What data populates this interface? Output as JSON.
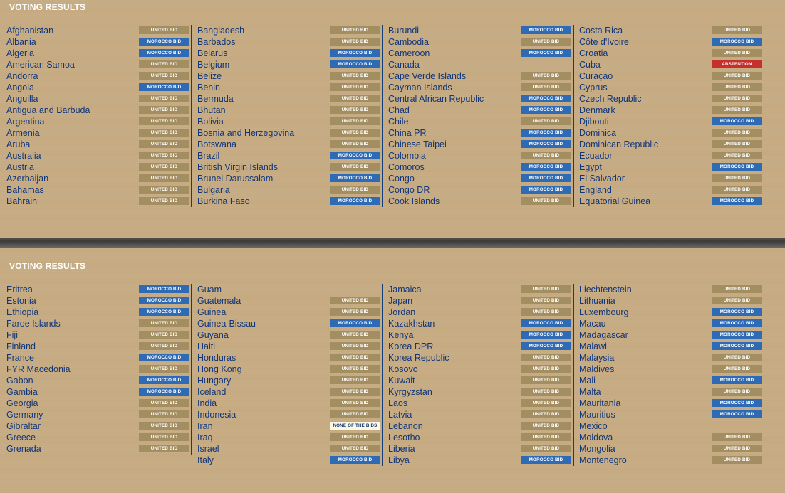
{
  "colors": {
    "background": "#c6ab82",
    "country_text": "#11367a",
    "united_bid": "#a38e62",
    "morocco_bid": "#2f6bb4",
    "abstention": "#c4302c",
    "none_of_the_bids": "#fbf8e6"
  },
  "panels": [
    {
      "title": "VOTING RESULTS",
      "columns": [
        [
          {
            "country": "Afghanistan",
            "vote": "UNITED BID"
          },
          {
            "country": "Albania",
            "vote": "MOROCCO BID"
          },
          {
            "country": "Algeria",
            "vote": "MOROCCO BID"
          },
          {
            "country": "American Samoa",
            "vote": "UNITED BID"
          },
          {
            "country": "Andorra",
            "vote": "UNITED BID"
          },
          {
            "country": "Angola",
            "vote": "MOROCCO BID"
          },
          {
            "country": "Anguilla",
            "vote": "UNITED BID"
          },
          {
            "country": "Antigua and Barbuda",
            "vote": "UNITED BID"
          },
          {
            "country": "Argentina",
            "vote": "UNITED BID"
          },
          {
            "country": "Armenia",
            "vote": "UNITED BID"
          },
          {
            "country": "Aruba",
            "vote": "UNITED BID"
          },
          {
            "country": "Australia",
            "vote": "UNITED BID"
          },
          {
            "country": "Austria",
            "vote": "UNITED BID"
          },
          {
            "country": "Azerbaijan",
            "vote": "UNITED BID"
          },
          {
            "country": "Bahamas",
            "vote": "UNITED BID"
          },
          {
            "country": "Bahrain",
            "vote": "UNITED BID"
          }
        ],
        [
          {
            "country": "Bangladesh",
            "vote": "UNITED BID"
          },
          {
            "country": "Barbados",
            "vote": "UNITED BID"
          },
          {
            "country": "Belarus",
            "vote": "MOROCCO BID"
          },
          {
            "country": "Belgium",
            "vote": "MOROCCO BID"
          },
          {
            "country": "Belize",
            "vote": "UNITED BID"
          },
          {
            "country": "Benin",
            "vote": "UNITED BID"
          },
          {
            "country": "Bermuda",
            "vote": "UNITED BID"
          },
          {
            "country": "Bhutan",
            "vote": "UNITED BID"
          },
          {
            "country": "Bolivia",
            "vote": "UNITED BID"
          },
          {
            "country": "Bosnia and Herzegovina",
            "vote": "UNITED BID"
          },
          {
            "country": "Botswana",
            "vote": "UNITED BID"
          },
          {
            "country": "Brazil",
            "vote": "MOROCCO BID"
          },
          {
            "country": "British Virgin Islands",
            "vote": "UNITED BID"
          },
          {
            "country": "Brunei Darussalam",
            "vote": "MOROCCO BID"
          },
          {
            "country": "Bulgaria",
            "vote": "UNITED BID"
          },
          {
            "country": "Burkina Faso",
            "vote": "MOROCCO BID"
          }
        ],
        [
          {
            "country": "Burundi",
            "vote": "MOROCCO BID"
          },
          {
            "country": "Cambodia",
            "vote": "UNITED BID"
          },
          {
            "country": "Cameroon",
            "vote": "MOROCCO BID"
          },
          {
            "country": "Canada",
            "vote": ""
          },
          {
            "country": "Cape Verde Islands",
            "vote": "UNITED BID"
          },
          {
            "country": "Cayman Islands",
            "vote": "UNITED BID"
          },
          {
            "country": "Central African Republic",
            "vote": "MOROCCO BID"
          },
          {
            "country": "Chad",
            "vote": "MOROCCO BID"
          },
          {
            "country": "Chile",
            "vote": "UNITED BID"
          },
          {
            "country": "China PR",
            "vote": "MOROCCO BID"
          },
          {
            "country": "Chinese Taipei",
            "vote": "MOROCCO BID"
          },
          {
            "country": "Colombia",
            "vote": "UNITED BID"
          },
          {
            "country": "Comoros",
            "vote": "MOROCCO BID"
          },
          {
            "country": "Congo",
            "vote": "MOROCCO BID"
          },
          {
            "country": "Congo DR",
            "vote": "MOROCCO BID"
          },
          {
            "country": "Cook Islands",
            "vote": "UNITED BID"
          }
        ],
        [
          {
            "country": "Costa Rica",
            "vote": "UNITED BID"
          },
          {
            "country": "Côte d'Ivoire",
            "vote": "MOROCCO BID"
          },
          {
            "country": "Croatia",
            "vote": "UNITED BID"
          },
          {
            "country": "Cuba",
            "vote": "ABSTENTION"
          },
          {
            "country": "Curaçao",
            "vote": "UNITED BID"
          },
          {
            "country": "Cyprus",
            "vote": "UNITED BID"
          },
          {
            "country": "Czech Republic",
            "vote": "UNITED BID"
          },
          {
            "country": "Denmark",
            "vote": "UNITED BID"
          },
          {
            "country": "Djibouti",
            "vote": "MOROCCO BID"
          },
          {
            "country": "Dominica",
            "vote": "UNITED BID"
          },
          {
            "country": "Dominican Republic",
            "vote": "UNITED BID"
          },
          {
            "country": "Ecuador",
            "vote": "UNITED BID"
          },
          {
            "country": "Egypt",
            "vote": "MOROCCO BID"
          },
          {
            "country": "El Salvador",
            "vote": "UNITED BID"
          },
          {
            "country": "England",
            "vote": "UNITED BID"
          },
          {
            "country": "Equatorial Guinea",
            "vote": "MOROCCO BID"
          }
        ]
      ]
    },
    {
      "title": "VOTING RESULTS",
      "columns": [
        [
          {
            "country": "Eritrea",
            "vote": "MOROCCO BID"
          },
          {
            "country": "Estonia",
            "vote": "MOROCCO BID"
          },
          {
            "country": "Ethiopia",
            "vote": "MOROCCO BID"
          },
          {
            "country": "Faroe Islands",
            "vote": "UNITED BID"
          },
          {
            "country": "Fiji",
            "vote": "UNITED BID"
          },
          {
            "country": "Finland",
            "vote": "UNITED BID"
          },
          {
            "country": "France",
            "vote": "MOROCCO BID"
          },
          {
            "country": "FYR Macedonia",
            "vote": "UNITED BID"
          },
          {
            "country": "Gabon",
            "vote": "MOROCCO BID"
          },
          {
            "country": "Gambia",
            "vote": "MOROCCO BID"
          },
          {
            "country": "Georgia",
            "vote": "UNITED BID"
          },
          {
            "country": "Germany",
            "vote": "UNITED BID"
          },
          {
            "country": "Gibraltar",
            "vote": "UNITED BID"
          },
          {
            "country": "Greece",
            "vote": "UNITED BID"
          },
          {
            "country": "Grenada",
            "vote": "UNITED BID"
          }
        ],
        [
          {
            "country": "Guam",
            "vote": ""
          },
          {
            "country": "Guatemala",
            "vote": "UNITED BID"
          },
          {
            "country": "Guinea",
            "vote": "UNITED BID"
          },
          {
            "country": "Guinea-Bissau",
            "vote": "MOROCCO BID"
          },
          {
            "country": "Guyana",
            "vote": "UNITED BID"
          },
          {
            "country": "Haiti",
            "vote": "UNITED BID"
          },
          {
            "country": "Honduras",
            "vote": "UNITED BID"
          },
          {
            "country": "Hong Kong",
            "vote": "UNITED BID"
          },
          {
            "country": "Hungary",
            "vote": "UNITED BID"
          },
          {
            "country": "Iceland",
            "vote": "UNITED BID"
          },
          {
            "country": "India",
            "vote": "UNITED BID"
          },
          {
            "country": "Indonesia",
            "vote": "UNITED BID"
          },
          {
            "country": "Iran",
            "vote": "NONE OF THE BIDS"
          },
          {
            "country": "Iraq",
            "vote": "UNITED BID"
          },
          {
            "country": "Israel",
            "vote": "UNITED BID"
          },
          {
            "country": "Italy",
            "vote": "MOROCCO BID"
          }
        ],
        [
          {
            "country": "Jamaica",
            "vote": "UNITED BID"
          },
          {
            "country": "Japan",
            "vote": "UNITED BID"
          },
          {
            "country": "Jordan",
            "vote": "UNITED BID"
          },
          {
            "country": "Kazakhstan",
            "vote": "MOROCCO BID"
          },
          {
            "country": "Kenya",
            "vote": "MOROCCO BID"
          },
          {
            "country": "Korea DPR",
            "vote": "MOROCCO BID"
          },
          {
            "country": "Korea Republic",
            "vote": "UNITED BID"
          },
          {
            "country": "Kosovo",
            "vote": "UNITED BID"
          },
          {
            "country": "Kuwait",
            "vote": "UNITED BID"
          },
          {
            "country": "Kyrgyzstan",
            "vote": "UNITED BID"
          },
          {
            "country": "Laos",
            "vote": "UNITED BID"
          },
          {
            "country": "Latvia",
            "vote": "UNITED BID"
          },
          {
            "country": "Lebanon",
            "vote": "UNITED BID"
          },
          {
            "country": "Lesotho",
            "vote": "UNITED BID"
          },
          {
            "country": "Liberia",
            "vote": "UNITED BID"
          },
          {
            "country": "Libya",
            "vote": "MOROCCO BID"
          }
        ],
        [
          {
            "country": "Liechtenstein",
            "vote": "UNITED BID"
          },
          {
            "country": "Lithuania",
            "vote": "UNITED BID"
          },
          {
            "country": "Luxembourg",
            "vote": "MOROCCO BID"
          },
          {
            "country": "Macau",
            "vote": "MOROCCO BID"
          },
          {
            "country": "Madagascar",
            "vote": "MOROCCO BID"
          },
          {
            "country": "Malawi",
            "vote": "MOROCCO BID"
          },
          {
            "country": "Malaysia",
            "vote": "UNITED BID"
          },
          {
            "country": "Maldives",
            "vote": "UNITED BID"
          },
          {
            "country": "Mali",
            "vote": "MOROCCO BID"
          },
          {
            "country": "Malta",
            "vote": "UNITED BID"
          },
          {
            "country": "Mauritania",
            "vote": "MOROCCO BID"
          },
          {
            "country": "Mauritius",
            "vote": "MOROCCO BID"
          },
          {
            "country": "Mexico",
            "vote": ""
          },
          {
            "country": "Moldova",
            "vote": "UNITED BID"
          },
          {
            "country": "Mongolia",
            "vote": "UNITED BID"
          },
          {
            "country": "Montenegro",
            "vote": "UNITED BID"
          }
        ]
      ]
    }
  ]
}
